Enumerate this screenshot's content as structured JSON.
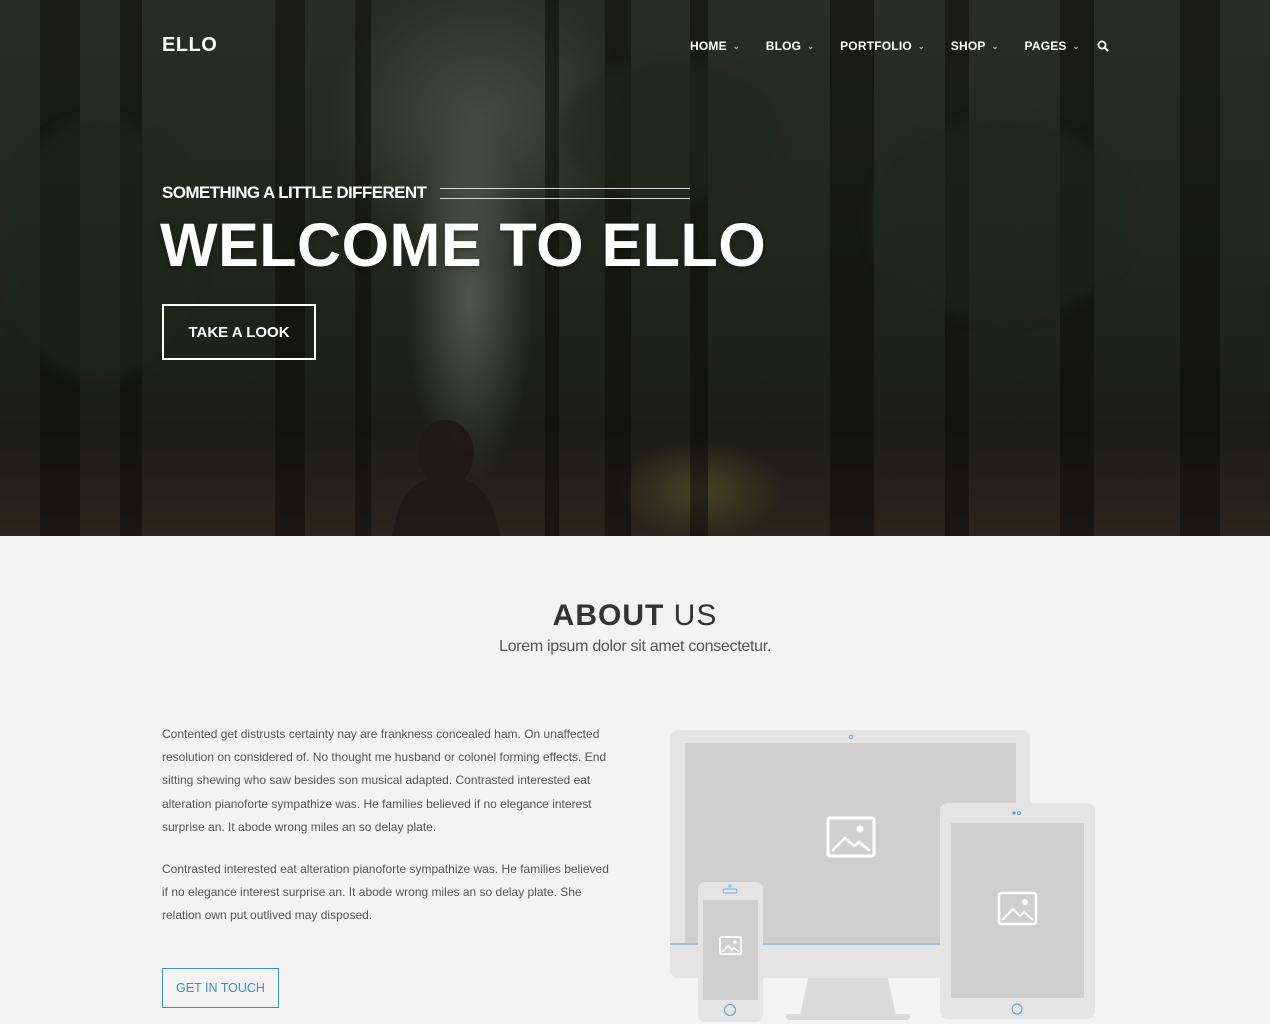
{
  "header": {
    "logo": "ELLO",
    "nav": [
      {
        "label": "HOME",
        "has_dropdown": true
      },
      {
        "label": "BLOG",
        "has_dropdown": true
      },
      {
        "label": "PORTFOLIO",
        "has_dropdown": true
      },
      {
        "label": "SHOP",
        "has_dropdown": true
      },
      {
        "label": "PAGES",
        "has_dropdown": true
      }
    ],
    "search_icon": "search-icon"
  },
  "hero": {
    "tagline": "SOMETHING A LITTLE DIFFERENT",
    "title": "WELCOME TO ELLO",
    "button_label": "TAKE A LOOK"
  },
  "about": {
    "title_bold": "ABOUT",
    "title_light": "US",
    "subtitle": "Lorem ipsum dolor sit amet consectetur.",
    "paragraphs": [
      "Contented get distrusts certainty nay are frankness concealed ham. On unaffected resolution on considered of. No thought me husband or colonel forming effects. End sitting shewing who saw besides son musical adapted. Contrasted interested eat alteration pianoforte sympathize was. He families believed if no elegance interest surprise an. It abode wrong miles an so delay plate.",
      "Contrasted interested eat alteration pianoforte sympathize was. He families believed if no elegance interest surprise an. It abode wrong miles an so delay plate. She relation own put outlived may disposed."
    ],
    "cta_label": "GET IN TOUCH"
  },
  "colors": {
    "accent": "#3a8fc4",
    "about_background": "#f3f3f3",
    "device_frame": "#e2e2e2",
    "device_screen": "#cfcfcf"
  }
}
